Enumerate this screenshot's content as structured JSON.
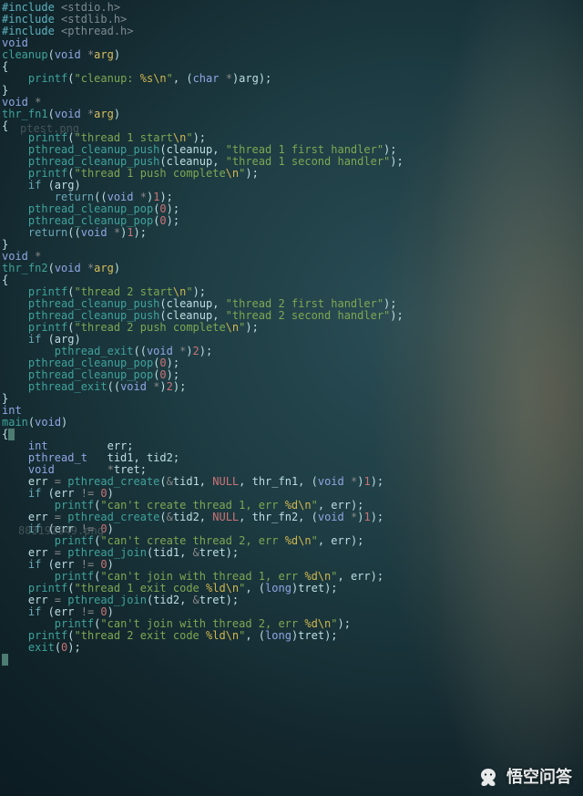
{
  "watermarks": {
    "a": "ptest.png",
    "b": "803192949.png"
  },
  "brand": "悟空问答",
  "lines": [
    [
      [
        "pp",
        "#include "
      ],
      [
        "ppinc",
        "<stdio.h>"
      ]
    ],
    [
      [
        "pp",
        "#include "
      ],
      [
        "ppinc",
        "<stdlib.h>"
      ]
    ],
    [
      [
        "pp",
        "#include "
      ],
      [
        "ppinc",
        "<pthread.h>"
      ]
    ],
    [
      [
        "t0",
        ""
      ]
    ],
    [
      [
        "ty",
        "void"
      ]
    ],
    [
      [
        "fn",
        "cleanup"
      ],
      [
        "t0",
        "("
      ],
      [
        "ty",
        "void "
      ],
      [
        "op",
        "*"
      ],
      [
        "ar",
        "arg"
      ],
      [
        "t0",
        ")"
      ]
    ],
    [
      [
        "t0",
        "{"
      ]
    ],
    [
      [
        "t0",
        "    "
      ],
      [
        "fn",
        "printf"
      ],
      [
        "t0",
        "("
      ],
      [
        "str",
        "\"cleanup: "
      ],
      [
        "esc",
        "%s\\n"
      ],
      [
        "str",
        "\""
      ],
      [
        "t0",
        ", ("
      ],
      [
        "ty",
        "char "
      ],
      [
        "op",
        "*"
      ],
      [
        "t0",
        ")arg);"
      ]
    ],
    [
      [
        "t0",
        "}"
      ]
    ],
    [
      [
        "t0",
        ""
      ]
    ],
    [
      [
        "ty",
        "void "
      ],
      [
        "op",
        "*"
      ]
    ],
    [
      [
        "fn",
        "thr_fn1"
      ],
      [
        "t0",
        "("
      ],
      [
        "ty",
        "void "
      ],
      [
        "op",
        "*"
      ],
      [
        "ar",
        "arg"
      ],
      [
        "t0",
        ")"
      ]
    ],
    [
      [
        "t0",
        "{"
      ]
    ],
    [
      [
        "t0",
        "    "
      ],
      [
        "fn",
        "printf"
      ],
      [
        "t0",
        "("
      ],
      [
        "str",
        "\"thread 1 start"
      ],
      [
        "esc",
        "\\n"
      ],
      [
        "str",
        "\""
      ],
      [
        "t0",
        ");"
      ]
    ],
    [
      [
        "t0",
        "    "
      ],
      [
        "fn",
        "pthread_cleanup_push"
      ],
      [
        "t0",
        "(cleanup, "
      ],
      [
        "str",
        "\"thread 1 first handler\""
      ],
      [
        "t0",
        ");"
      ]
    ],
    [
      [
        "t0",
        "    "
      ],
      [
        "fn",
        "pthread_cleanup_push"
      ],
      [
        "t0",
        "(cleanup, "
      ],
      [
        "str",
        "\"thread 1 second handler\""
      ],
      [
        "t0",
        ");"
      ]
    ],
    [
      [
        "t0",
        "    "
      ],
      [
        "fn",
        "printf"
      ],
      [
        "t0",
        "("
      ],
      [
        "str",
        "\"thread 1 push complete"
      ],
      [
        "esc",
        "\\n"
      ],
      [
        "str",
        "\""
      ],
      [
        "t0",
        ");"
      ]
    ],
    [
      [
        "t0",
        "    "
      ],
      [
        "kw",
        "if"
      ],
      [
        "t0",
        " (arg)"
      ]
    ],
    [
      [
        "t0",
        "        "
      ],
      [
        "kw",
        "return"
      ],
      [
        "t0",
        "(("
      ],
      [
        "ty",
        "void "
      ],
      [
        "op",
        "*"
      ],
      [
        "t0",
        ")"
      ],
      [
        "num",
        "1"
      ],
      [
        "t0",
        ");"
      ]
    ],
    [
      [
        "t0",
        "    "
      ],
      [
        "fn",
        "pthread_cleanup_pop"
      ],
      [
        "t0",
        "("
      ],
      [
        "num",
        "0"
      ],
      [
        "t0",
        ");"
      ]
    ],
    [
      [
        "t0",
        "    "
      ],
      [
        "fn",
        "pthread_cleanup_pop"
      ],
      [
        "t0",
        "("
      ],
      [
        "num",
        "0"
      ],
      [
        "t0",
        ");"
      ]
    ],
    [
      [
        "t0",
        "    "
      ],
      [
        "kw",
        "return"
      ],
      [
        "t0",
        "(("
      ],
      [
        "ty",
        "void "
      ],
      [
        "op",
        "*"
      ],
      [
        "t0",
        ")"
      ],
      [
        "num",
        "1"
      ],
      [
        "t0",
        ");"
      ]
    ],
    [
      [
        "t0",
        "}"
      ]
    ],
    [
      [
        "t0",
        ""
      ]
    ],
    [
      [
        "ty",
        "void "
      ],
      [
        "op",
        "*"
      ]
    ],
    [
      [
        "fn",
        "thr_fn2"
      ],
      [
        "t0",
        "("
      ],
      [
        "ty",
        "void "
      ],
      [
        "op",
        "*"
      ],
      [
        "ar",
        "arg"
      ],
      [
        "t0",
        ")"
      ]
    ],
    [
      [
        "t0",
        "{"
      ]
    ],
    [
      [
        "t0",
        "    "
      ],
      [
        "fn",
        "printf"
      ],
      [
        "t0",
        "("
      ],
      [
        "str",
        "\"thread 2 start"
      ],
      [
        "esc",
        "\\n"
      ],
      [
        "str",
        "\""
      ],
      [
        "t0",
        ");"
      ]
    ],
    [
      [
        "t0",
        "    "
      ],
      [
        "fn",
        "pthread_cleanup_push"
      ],
      [
        "t0",
        "(cleanup, "
      ],
      [
        "str",
        "\"thread 2 first handler\""
      ],
      [
        "t0",
        ");"
      ]
    ],
    [
      [
        "t0",
        "    "
      ],
      [
        "fn",
        "pthread_cleanup_push"
      ],
      [
        "t0",
        "(cleanup, "
      ],
      [
        "str",
        "\"thread 2 second handler\""
      ],
      [
        "t0",
        ");"
      ]
    ],
    [
      [
        "t0",
        "    "
      ],
      [
        "fn",
        "printf"
      ],
      [
        "t0",
        "("
      ],
      [
        "str",
        "\"thread 2 push complete"
      ],
      [
        "esc",
        "\\n"
      ],
      [
        "str",
        "\""
      ],
      [
        "t0",
        ");"
      ]
    ],
    [
      [
        "t0",
        "    "
      ],
      [
        "kw",
        "if"
      ],
      [
        "t0",
        " (arg)"
      ]
    ],
    [
      [
        "t0",
        "        "
      ],
      [
        "fn",
        "pthread_exit"
      ],
      [
        "t0",
        "(("
      ],
      [
        "ty",
        "void "
      ],
      [
        "op",
        "*"
      ],
      [
        "t0",
        ")"
      ],
      [
        "num",
        "2"
      ],
      [
        "t0",
        ");"
      ]
    ],
    [
      [
        "t0",
        "    "
      ],
      [
        "fn",
        "pthread_cleanup_pop"
      ],
      [
        "t0",
        "("
      ],
      [
        "num",
        "0"
      ],
      [
        "t0",
        ");"
      ]
    ],
    [
      [
        "t0",
        "    "
      ],
      [
        "fn",
        "pthread_cleanup_pop"
      ],
      [
        "t0",
        "("
      ],
      [
        "num",
        "0"
      ],
      [
        "t0",
        ");"
      ]
    ],
    [
      [
        "t0",
        "    "
      ],
      [
        "fn",
        "pthread_exit"
      ],
      [
        "t0",
        "(("
      ],
      [
        "ty",
        "void "
      ],
      [
        "op",
        "*"
      ],
      [
        "t0",
        ")"
      ],
      [
        "num",
        "2"
      ],
      [
        "t0",
        ");"
      ]
    ],
    [
      [
        "t0",
        "}"
      ]
    ],
    [
      [
        "t0",
        ""
      ]
    ],
    [
      [
        "ty",
        "int"
      ]
    ],
    [
      [
        "fn",
        "main"
      ],
      [
        "t0",
        "("
      ],
      [
        "ty",
        "void"
      ],
      [
        "t0",
        ")"
      ]
    ],
    [
      [
        "t0",
        "{"
      ],
      [
        "cursor",
        ""
      ]
    ],
    [
      [
        "t0",
        ""
      ]
    ],
    [
      [
        "t0",
        "    "
      ],
      [
        "ty",
        "int"
      ],
      [
        "t0",
        "         err;"
      ]
    ],
    [
      [
        "t0",
        "    "
      ],
      [
        "ty",
        "pthread_t"
      ],
      [
        "t0",
        "   tid1, tid2;"
      ]
    ],
    [
      [
        "t0",
        "    "
      ],
      [
        "ty",
        "void"
      ],
      [
        "t0",
        "        "
      ],
      [
        "op",
        "*"
      ],
      [
        "t0",
        "tret;"
      ]
    ],
    [
      [
        "t0",
        ""
      ]
    ],
    [
      [
        "t0",
        "    err "
      ],
      [
        "op",
        "="
      ],
      [
        "t0",
        " "
      ],
      [
        "fn",
        "pthread_create"
      ],
      [
        "t0",
        "("
      ],
      [
        "op",
        "&"
      ],
      [
        "t0",
        "tid1, "
      ],
      [
        "num",
        "NULL"
      ],
      [
        "t0",
        ", thr_fn1, ("
      ],
      [
        "ty",
        "void "
      ],
      [
        "op",
        "*"
      ],
      [
        "t0",
        ")"
      ],
      [
        "num",
        "1"
      ],
      [
        "t0",
        ");"
      ]
    ],
    [
      [
        "t0",
        "    "
      ],
      [
        "kw",
        "if"
      ],
      [
        "t0",
        " (err "
      ],
      [
        "op",
        "!="
      ],
      [
        "t0",
        " "
      ],
      [
        "num",
        "0"
      ],
      [
        "t0",
        ")"
      ]
    ],
    [
      [
        "t0",
        "        "
      ],
      [
        "fn",
        "printf"
      ],
      [
        "t0",
        "("
      ],
      [
        "str",
        "\"can't create thread 1, err "
      ],
      [
        "esc",
        "%d\\n"
      ],
      [
        "str",
        "\""
      ],
      [
        "t0",
        ", err);"
      ]
    ],
    [
      [
        "t0",
        "    err "
      ],
      [
        "op",
        "="
      ],
      [
        "t0",
        " "
      ],
      [
        "fn",
        "pthread_create"
      ],
      [
        "t0",
        "("
      ],
      [
        "op",
        "&"
      ],
      [
        "t0",
        "tid2, "
      ],
      [
        "num",
        "NULL"
      ],
      [
        "t0",
        ", thr_fn2, ("
      ],
      [
        "ty",
        "void "
      ],
      [
        "op",
        "*"
      ],
      [
        "t0",
        ")"
      ],
      [
        "num",
        "1"
      ],
      [
        "t0",
        ");"
      ]
    ],
    [
      [
        "t0",
        "    "
      ],
      [
        "kw",
        "if"
      ],
      [
        "t0",
        " (err "
      ],
      [
        "op",
        "!="
      ],
      [
        "t0",
        " "
      ],
      [
        "num",
        "0"
      ],
      [
        "t0",
        ")"
      ]
    ],
    [
      [
        "t0",
        "        "
      ],
      [
        "fn",
        "printf"
      ],
      [
        "t0",
        "("
      ],
      [
        "str",
        "\"can't create thread 2, err "
      ],
      [
        "esc",
        "%d\\n"
      ],
      [
        "str",
        "\""
      ],
      [
        "t0",
        ", err);"
      ]
    ],
    [
      [
        "t0",
        "    err "
      ],
      [
        "op",
        "="
      ],
      [
        "t0",
        " "
      ],
      [
        "fn",
        "pthread_join"
      ],
      [
        "t0",
        "(tid1, "
      ],
      [
        "op",
        "&"
      ],
      [
        "t0",
        "tret);"
      ]
    ],
    [
      [
        "t0",
        "    "
      ],
      [
        "kw",
        "if"
      ],
      [
        "t0",
        " (err "
      ],
      [
        "op",
        "!="
      ],
      [
        "t0",
        " "
      ],
      [
        "num",
        "0"
      ],
      [
        "t0",
        ")"
      ]
    ],
    [
      [
        "t0",
        "        "
      ],
      [
        "fn",
        "printf"
      ],
      [
        "t0",
        "("
      ],
      [
        "str",
        "\"can't join with thread 1, err "
      ],
      [
        "esc",
        "%d\\n"
      ],
      [
        "str",
        "\""
      ],
      [
        "t0",
        ", err);"
      ]
    ],
    [
      [
        "t0",
        "    "
      ],
      [
        "fn",
        "printf"
      ],
      [
        "t0",
        "("
      ],
      [
        "str",
        "\"thread 1 exit code "
      ],
      [
        "esc",
        "%ld\\n"
      ],
      [
        "str",
        "\""
      ],
      [
        "t0",
        ", ("
      ],
      [
        "ty",
        "long"
      ],
      [
        "t0",
        ")tret);"
      ]
    ],
    [
      [
        "t0",
        "    err "
      ],
      [
        "op",
        "="
      ],
      [
        "t0",
        " "
      ],
      [
        "fn",
        "pthread_join"
      ],
      [
        "t0",
        "(tid2, "
      ],
      [
        "op",
        "&"
      ],
      [
        "t0",
        "tret);"
      ]
    ],
    [
      [
        "t0",
        "    "
      ],
      [
        "kw",
        "if"
      ],
      [
        "t0",
        " (err "
      ],
      [
        "op",
        "!="
      ],
      [
        "t0",
        " "
      ],
      [
        "num",
        "0"
      ],
      [
        "t0",
        ")"
      ]
    ],
    [
      [
        "t0",
        "        "
      ],
      [
        "fn",
        "printf"
      ],
      [
        "t0",
        "("
      ],
      [
        "str",
        "\"can't join with thread 2, err "
      ],
      [
        "esc",
        "%d\\n"
      ],
      [
        "str",
        "\""
      ],
      [
        "t0",
        ");"
      ]
    ],
    [
      [
        "t0",
        "    "
      ],
      [
        "fn",
        "printf"
      ],
      [
        "t0",
        "("
      ],
      [
        "str",
        "\"thread 2 exit code "
      ],
      [
        "esc",
        "%ld\\n"
      ],
      [
        "str",
        "\""
      ],
      [
        "t0",
        ", ("
      ],
      [
        "ty",
        "long"
      ],
      [
        "t0",
        ")tret);"
      ]
    ],
    [
      [
        "t0",
        "    "
      ],
      [
        "fn",
        "exit"
      ],
      [
        "t0",
        "("
      ],
      [
        "num",
        "0"
      ],
      [
        "t0",
        ");"
      ]
    ],
    [
      [
        "cursor",
        ""
      ]
    ]
  ]
}
